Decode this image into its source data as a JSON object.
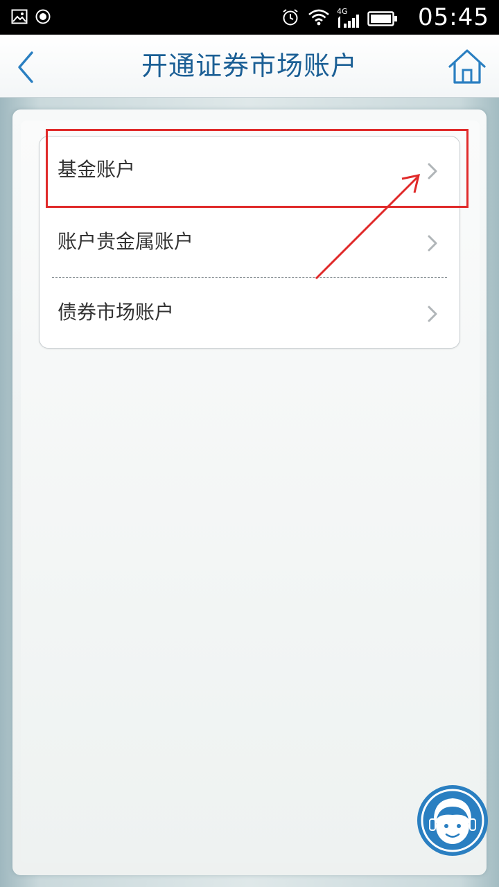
{
  "status_bar": {
    "time": "05:45",
    "network": "4G",
    "icons": [
      "image-icon",
      "record-icon",
      "alarm-icon",
      "wifi-icon",
      "signal-icon",
      "battery-icon"
    ]
  },
  "nav": {
    "title": "开通证券市场账户",
    "back_icon": "chevron-left-icon",
    "home_icon": "home-icon"
  },
  "menu": {
    "items": [
      {
        "label": "基金账户"
      },
      {
        "label": "账户贵金属账户"
      },
      {
        "label": "债券市场账户"
      }
    ]
  },
  "annotation": {
    "highlighted_item": "基金账户",
    "color": "#e02a2a"
  },
  "colors": {
    "title_blue": "#1b5f95",
    "accent_blue": "#2a7fc1"
  },
  "customer_service": {
    "icon": "customer-service-icon"
  }
}
